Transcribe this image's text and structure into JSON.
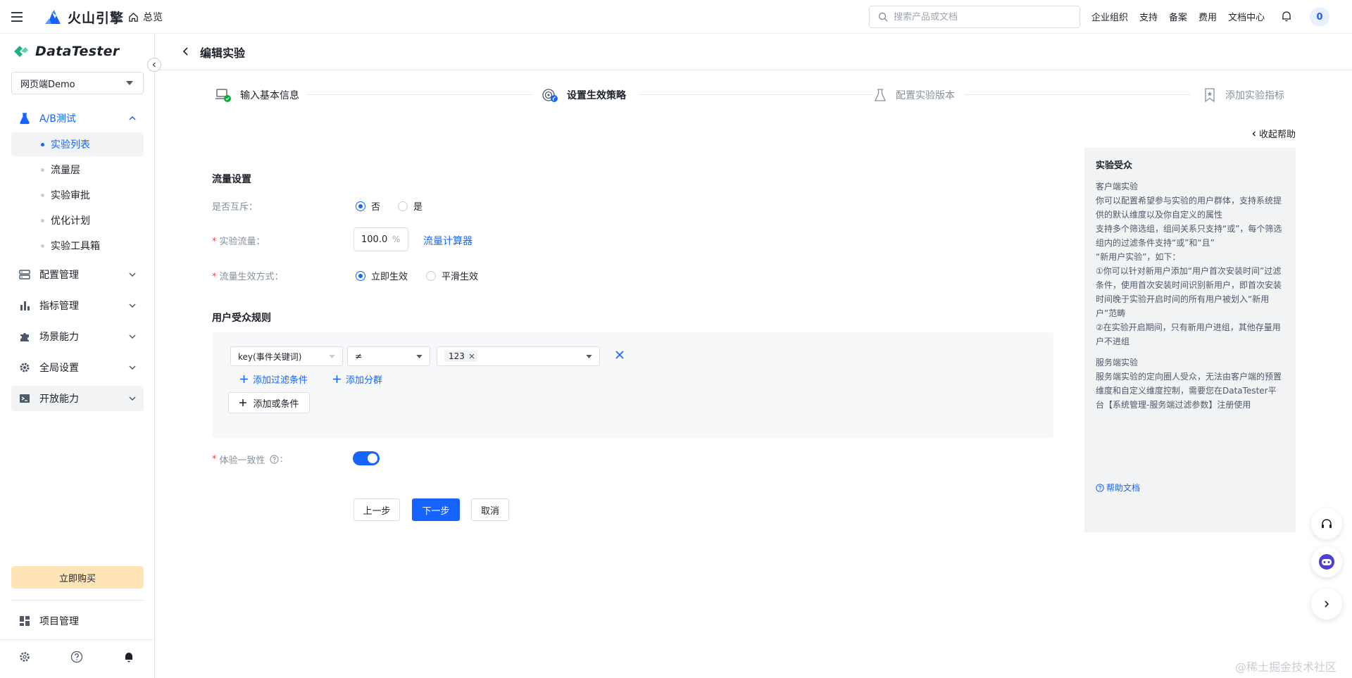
{
  "topbar": {
    "brand": "火山引擎",
    "overview": "总览",
    "search_placeholder": "搜索产品或文档",
    "nav": [
      "企业组织",
      "支持",
      "备案",
      "费用",
      "文档中心"
    ],
    "avatar": "0"
  },
  "sidebar": {
    "product": "DataTester",
    "project_select": "网页端Demo",
    "groups": [
      {
        "label": "A/B测试"
      },
      {
        "label": "配置管理"
      },
      {
        "label": "指标管理"
      },
      {
        "label": "场景能力"
      },
      {
        "label": "全局设置"
      },
      {
        "label": "开放能力"
      }
    ],
    "sub_items": [
      "实验列表",
      "流量层",
      "实验审批",
      "优化计划",
      "实验工具箱"
    ],
    "buy": "立即购买",
    "project_manage": "项目管理"
  },
  "page": {
    "title": "编辑实验",
    "steps": [
      "输入基本信息",
      "设置生效策略",
      "配置实验版本",
      "添加实验指标"
    ],
    "collapse_help": "收起帮助"
  },
  "form": {
    "traffic_section": "流量设置",
    "mutex_label": "是否互斥：",
    "mutex_options": [
      "否",
      "是"
    ],
    "flow_label": "实验流量：",
    "flow_value": "100.0",
    "flow_unit": "%",
    "flow_calc": "流量计算器",
    "effect_label": "流量生效方式：",
    "effect_options": [
      "立即生效",
      "平滑生效"
    ],
    "audience_section": "用户受众规则",
    "rule": {
      "key": "key(事件关键词)",
      "op": "≠",
      "value": "123"
    },
    "add_filter": "添加过滤条件",
    "add_group": "添加分群",
    "add_or": "添加或条件",
    "consistency_label": "体验一致性",
    "consistency_on": true,
    "buttons": {
      "prev": "上一步",
      "next": "下一步",
      "cancel": "取消"
    }
  },
  "help": {
    "title": "实验受众",
    "paragraphs_a": [
      "客户端实验",
      "你可以配置希望参与实验的用户群体，支持系统提供的默认维度以及你自定义的属性",
      "支持多个筛选组，组间关系只支持“或”，每个筛选组内的过滤条件支持“或”和“且”",
      "“新用户实验”，如下：",
      "①你可以针对新用户添加“用户首次安装时间”过滤条件，使用首次安装时间识别新用户，即首次安装时间晚于实验开启时间的所有用户被划入“新用户”范畴",
      "②在实验开启期间，只有新用户进组，其他存量用户不进组"
    ],
    "paragraphs_b": [
      "服务端实验",
      "服务端实验的定向圈人受众，无法由客户端的预置维度和自定义维度控制，需要您在DataTester平台【系统管理-服务端过滤参数】注册使用"
    ],
    "doc_link": "帮助文档"
  },
  "watermark": "@稀土掘金技术社区",
  "colors": {
    "primary": "#1664ff",
    "buy": "#ffe4b5",
    "required": "#f53f3f"
  }
}
